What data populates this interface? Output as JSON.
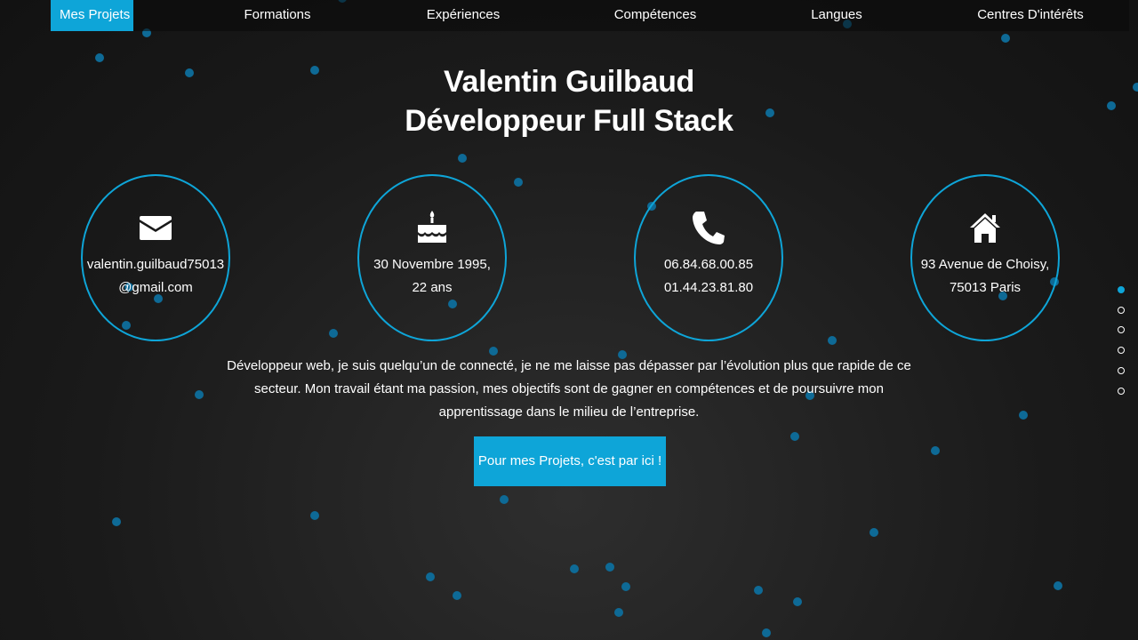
{
  "nav": {
    "items": [
      {
        "label": "Mes Projets",
        "active": true
      },
      {
        "label": "Formations",
        "active": false
      },
      {
        "label": "Expériences",
        "active": false
      },
      {
        "label": "Compétences",
        "active": false
      },
      {
        "label": "Langues",
        "active": false
      },
      {
        "label": "Centres D'intérêts",
        "active": false
      }
    ]
  },
  "hero": {
    "name": "Valentin Guilbaud",
    "role": "Développeur Full Stack"
  },
  "info": [
    {
      "icon": "envelope-icon",
      "line1": "valentin.guilbaud75013",
      "line2": "@gmail.com"
    },
    {
      "icon": "birthday-cake-icon",
      "line1": "30 Novembre 1995,",
      "line2": "22 ans"
    },
    {
      "icon": "phone-icon",
      "line1": "06.84.68.00.85",
      "line2": "01.44.23.81.80"
    },
    {
      "icon": "home-icon",
      "line1": "93 Avenue de Choisy,",
      "line2": "75013 Paris"
    }
  ],
  "description": "Développeur web, je suis quelqu’un de connecté, je ne me laisse pas dépasser par l’évolution plus que rapide de ce secteur. Mon travail étant ma passion, mes objectifs sont de gagner en compétences et de poursuivre mon apprentissage dans le milieu de l’entreprise.",
  "cta": {
    "label": "Pour mes Projets, c'est par ici !"
  },
  "side_nav": {
    "count": 6,
    "active_index": 0
  },
  "colors": {
    "accent": "#0ea5d8",
    "particle": "#0e6a96",
    "background": "#1e1e1e",
    "text": "#ffffff"
  }
}
